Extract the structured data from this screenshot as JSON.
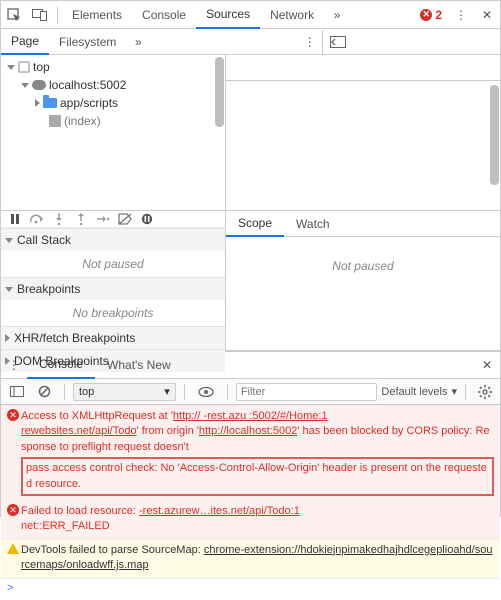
{
  "toolbar": {
    "tabs": [
      "Elements",
      "Console",
      "Sources",
      "Network"
    ],
    "active": 2,
    "errors": "2"
  },
  "page_tabs": {
    "items": [
      "Page",
      "Filesystem"
    ],
    "active": 0
  },
  "tree": {
    "root": "top",
    "host": "localhost:5002",
    "folder": "app/scripts",
    "file": "(index)"
  },
  "debugger": {
    "callstack_label": "Call Stack",
    "not_paused": "Not paused",
    "breakpoints_label": "Breakpoints",
    "no_breakpoints": "No breakpoints",
    "xhr_label": "XHR/fetch Breakpoints",
    "dom_label": "DOM Breakpoints"
  },
  "scope_tabs": {
    "items": [
      "Scope",
      "Watch"
    ],
    "active": 0,
    "body": "Not paused"
  },
  "drawer": {
    "tabs": [
      "Console",
      "What's New"
    ],
    "active": 0
  },
  "filterbar": {
    "context": "top",
    "filter_placeholder": "Filter",
    "levels": "Default levels"
  },
  "console": {
    "msg1_pre": "Access to XMLHttpRequest at '",
    "msg1_url1": "http://        -rest.azu :5002/#/Home:1",
    "msg1_mid1": "rewebsites.net/api/Todo",
    "msg1_mid2": "' from origin '",
    "msg1_url2": "http://localhost:5002",
    "msg1_mid3": "' has been blocked by CORS policy: Response to preflight request doesn't",
    "msg1_hilite": "pass access control check: No 'Access-Control-Allow-Origin' header is present on the requested resource.",
    "msg2_pre": "Failed to load resource:        ",
    "msg2_url": "-rest.azurew…ites.net/api/Todo:1",
    "msg2_post": "net::ERR_FAILED",
    "msg3_pre": "DevTools failed to parse SourceMap: ",
    "msg3_url": "chrome-extension://hdokiejnpimakedhajhdlcegeplioahd/sourcemaps/onloadwff.js.map",
    "prompt": ">"
  }
}
